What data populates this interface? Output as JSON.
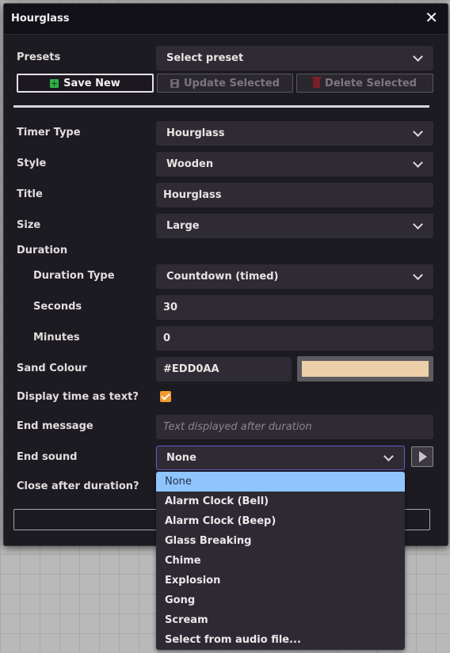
{
  "window": {
    "title": "Hourglass"
  },
  "presets": {
    "label": "Presets",
    "value": "Select preset",
    "save_new": "Save New",
    "update_selected": "Update Selected",
    "delete_selected": "Delete Selected"
  },
  "form": {
    "timer_type": {
      "label": "Timer Type",
      "value": "Hourglass"
    },
    "style": {
      "label": "Style",
      "value": "Wooden"
    },
    "title": {
      "label": "Title",
      "value": "Hourglass"
    },
    "size": {
      "label": "Size",
      "value": "Large"
    },
    "duration": {
      "label": "Duration",
      "type": {
        "label": "Duration Type",
        "value": "Countdown (timed)"
      },
      "seconds": {
        "label": "Seconds",
        "value": "30"
      },
      "minutes": {
        "label": "Minutes",
        "value": "0"
      }
    },
    "sand_colour": {
      "label": "Sand Colour",
      "value": "#EDD0AA",
      "swatch": "#EDD0AA"
    },
    "display_time_as_text": {
      "label": "Display time as text?",
      "checked": true
    },
    "end_message": {
      "label": "End message",
      "placeholder": "Text displayed after duration"
    },
    "end_sound": {
      "label": "End sound",
      "value": "None",
      "options": [
        "None",
        "Alarm Clock (Bell)",
        "Alarm Clock (Beep)",
        "Glass Breaking",
        "Chime",
        "Explosion",
        "Gong",
        "Scream",
        "Select from audio file..."
      ]
    },
    "close_after_duration": {
      "label": "Close after duration?"
    }
  },
  "colors": {
    "accent_checkbox": "#F29A2E",
    "selected_option": "#8FC4FD",
    "dialog_bg": "#1D1B22",
    "field_bg": "#2F2B34"
  }
}
